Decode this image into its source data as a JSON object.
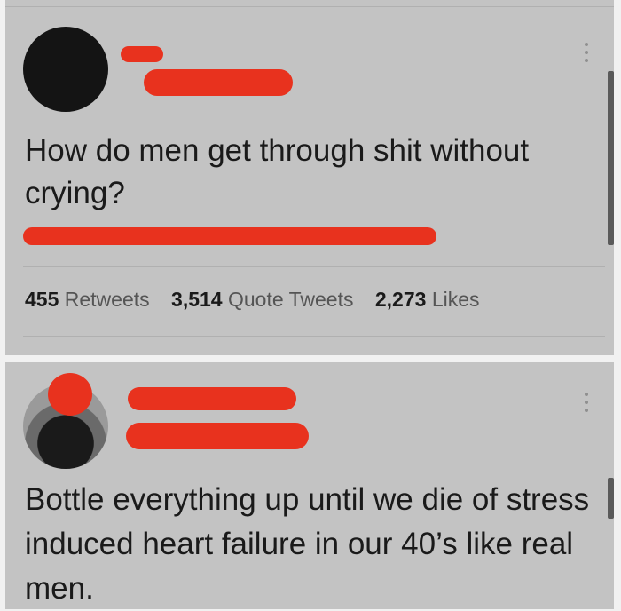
{
  "tweet1": {
    "text": "How do men get through shit without crying?",
    "stats": [
      {
        "count": "455",
        "label": "Retweets"
      },
      {
        "count": "3,514",
        "label": "Quote Tweets"
      },
      {
        "count": "2,273",
        "label": "Likes"
      }
    ]
  },
  "tweet2": {
    "text": "Bottle everything up until we die of stress induced heart failure in our 40’s like real men."
  },
  "colors": {
    "redaction": "#e8321e",
    "card_background": "#c3c3c3"
  }
}
